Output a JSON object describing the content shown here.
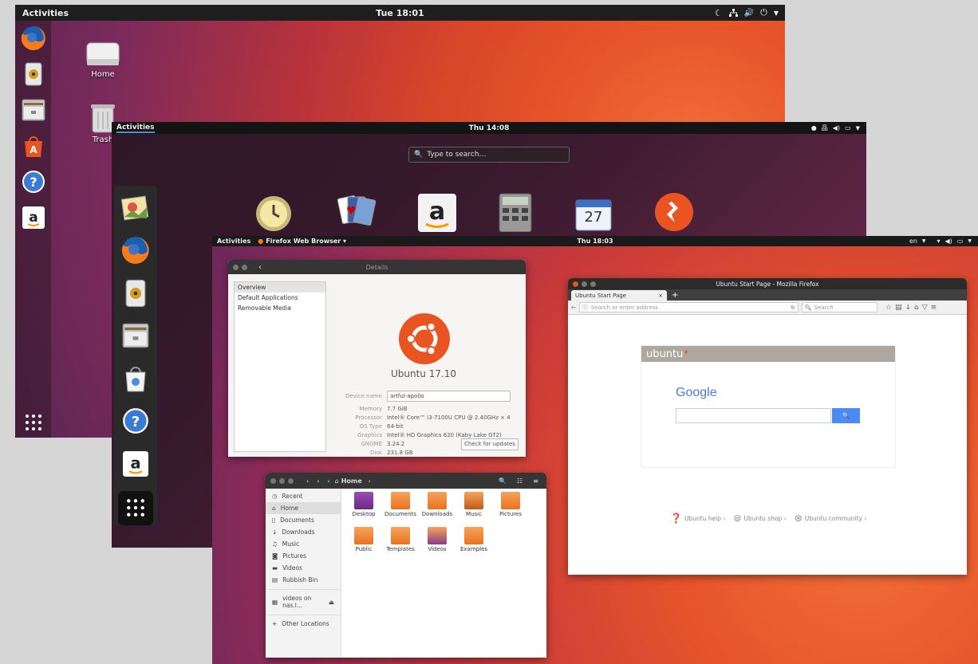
{
  "shot1": {
    "activities": "Activities",
    "clock": "Tue 18:01",
    "desktop_icons": [
      {
        "label": "Home"
      },
      {
        "label": "Trash"
      }
    ]
  },
  "shot2": {
    "activities": "Activities",
    "clock": "Thu 14:08",
    "search_placeholder": "Type to search…",
    "calendar_day": "27"
  },
  "shot3": {
    "activities": "Activities",
    "app_menu": "Firefox Web Browser ▾",
    "clock": "Thu 18:03",
    "lang": "en",
    "details": {
      "title": "Details",
      "sidebar": [
        "Overview",
        "Default Applications",
        "Removable Media"
      ],
      "os_name": "Ubuntu 17.10",
      "device_name_label": "Device name",
      "device_name_value": "artful-apollo",
      "rows": [
        {
          "k": "Memory",
          "v": "7.7 GiB"
        },
        {
          "k": "Processor",
          "v": "Intel® Core™ i3-7100U CPU @ 2.40GHz × 4"
        },
        {
          "k": "OS Type",
          "v": "64-bit"
        },
        {
          "k": "Graphics",
          "v": "Intel® HD Graphics 620 (Kaby Lake GT2)"
        },
        {
          "k": "GNOME",
          "v": "3.24.2"
        },
        {
          "k": "Disk",
          "v": "231.8 GB"
        }
      ],
      "check_updates": "Check for updates"
    },
    "files": {
      "path": "Home",
      "sidebar": [
        "Recent",
        "Home",
        "Documents",
        "Downloads",
        "Music",
        "Pictures",
        "Videos",
        "Rubbish Bin",
        "videos on nas.l...",
        "Other Locations"
      ],
      "folders": [
        "Desktop",
        "Documents",
        "Downloads",
        "Music",
        "Pictures",
        "Public",
        "Templates",
        "Videos",
        "Examples"
      ]
    },
    "firefox": {
      "window_title": "Ubuntu Start Page - Mozilla Firefox",
      "tab_title": "Ubuntu Start Page",
      "url_placeholder": "Search or enter address",
      "search_placeholder": "Search",
      "brand": "ubuntu",
      "google": "Google",
      "links": [
        "Ubuntu help ›",
        "Ubuntu shop ›",
        "Ubuntu community ›"
      ]
    }
  }
}
